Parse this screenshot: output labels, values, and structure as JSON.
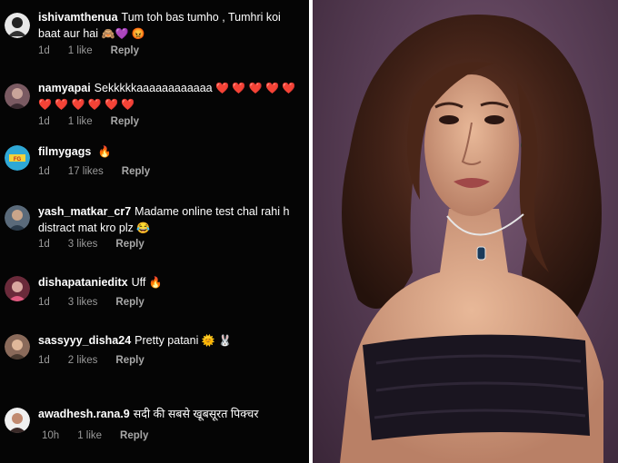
{
  "comments": [
    {
      "username": "ishivamthenua",
      "text": "Tum toh bas tumho , Tumhri koi baat aur hai",
      "emoji": "🙈💜 😡",
      "time": "1d",
      "likes": "1 like",
      "reply": "Reply",
      "avatar_color": "#d9d9d9"
    },
    {
      "username": "namyapai",
      "text": "Sekkkkkaaaaaaaaaaaa",
      "emoji": "❤️ ❤️ ❤️ ❤️ ❤️ ❤️ ❤️ ❤️ ❤️ ❤️ ❤️",
      "time": "1d",
      "likes": "1 like",
      "reply": "Reply",
      "avatar_color": "#8a6a70"
    },
    {
      "username": "filmygags",
      "text": "",
      "emoji": "🔥",
      "time": "1d",
      "likes": "17 likes",
      "reply": "Reply",
      "avatar_color": "#2fa8d6"
    },
    {
      "username": "yash_matkar_cr7",
      "text": "Madame online test chal rahi h distract mat kro plz",
      "emoji": "😂",
      "time": "1d",
      "likes": "3 likes",
      "reply": "Reply",
      "avatar_color": "#6a7a8a"
    },
    {
      "username": "dishapatanieditx",
      "text": "Uff",
      "emoji": "🔥",
      "time": "1d",
      "likes": "3 likes",
      "reply": "Reply",
      "avatar_color": "#c06080"
    },
    {
      "username": "sassyyy_disha24",
      "text": "Pretty patani",
      "emoji": "🌞 🐰",
      "time": "1d",
      "likes": "2 likes",
      "reply": "Reply",
      "avatar_color": "#9a7a6a"
    },
    {
      "username": "awadhesh.rana.9",
      "text": "सदी की सबसे खूबसूरत पिक्चर",
      "emoji": "",
      "time": "10h",
      "likes": "1 like",
      "reply": "Reply",
      "avatar_color": "#b08070"
    }
  ]
}
